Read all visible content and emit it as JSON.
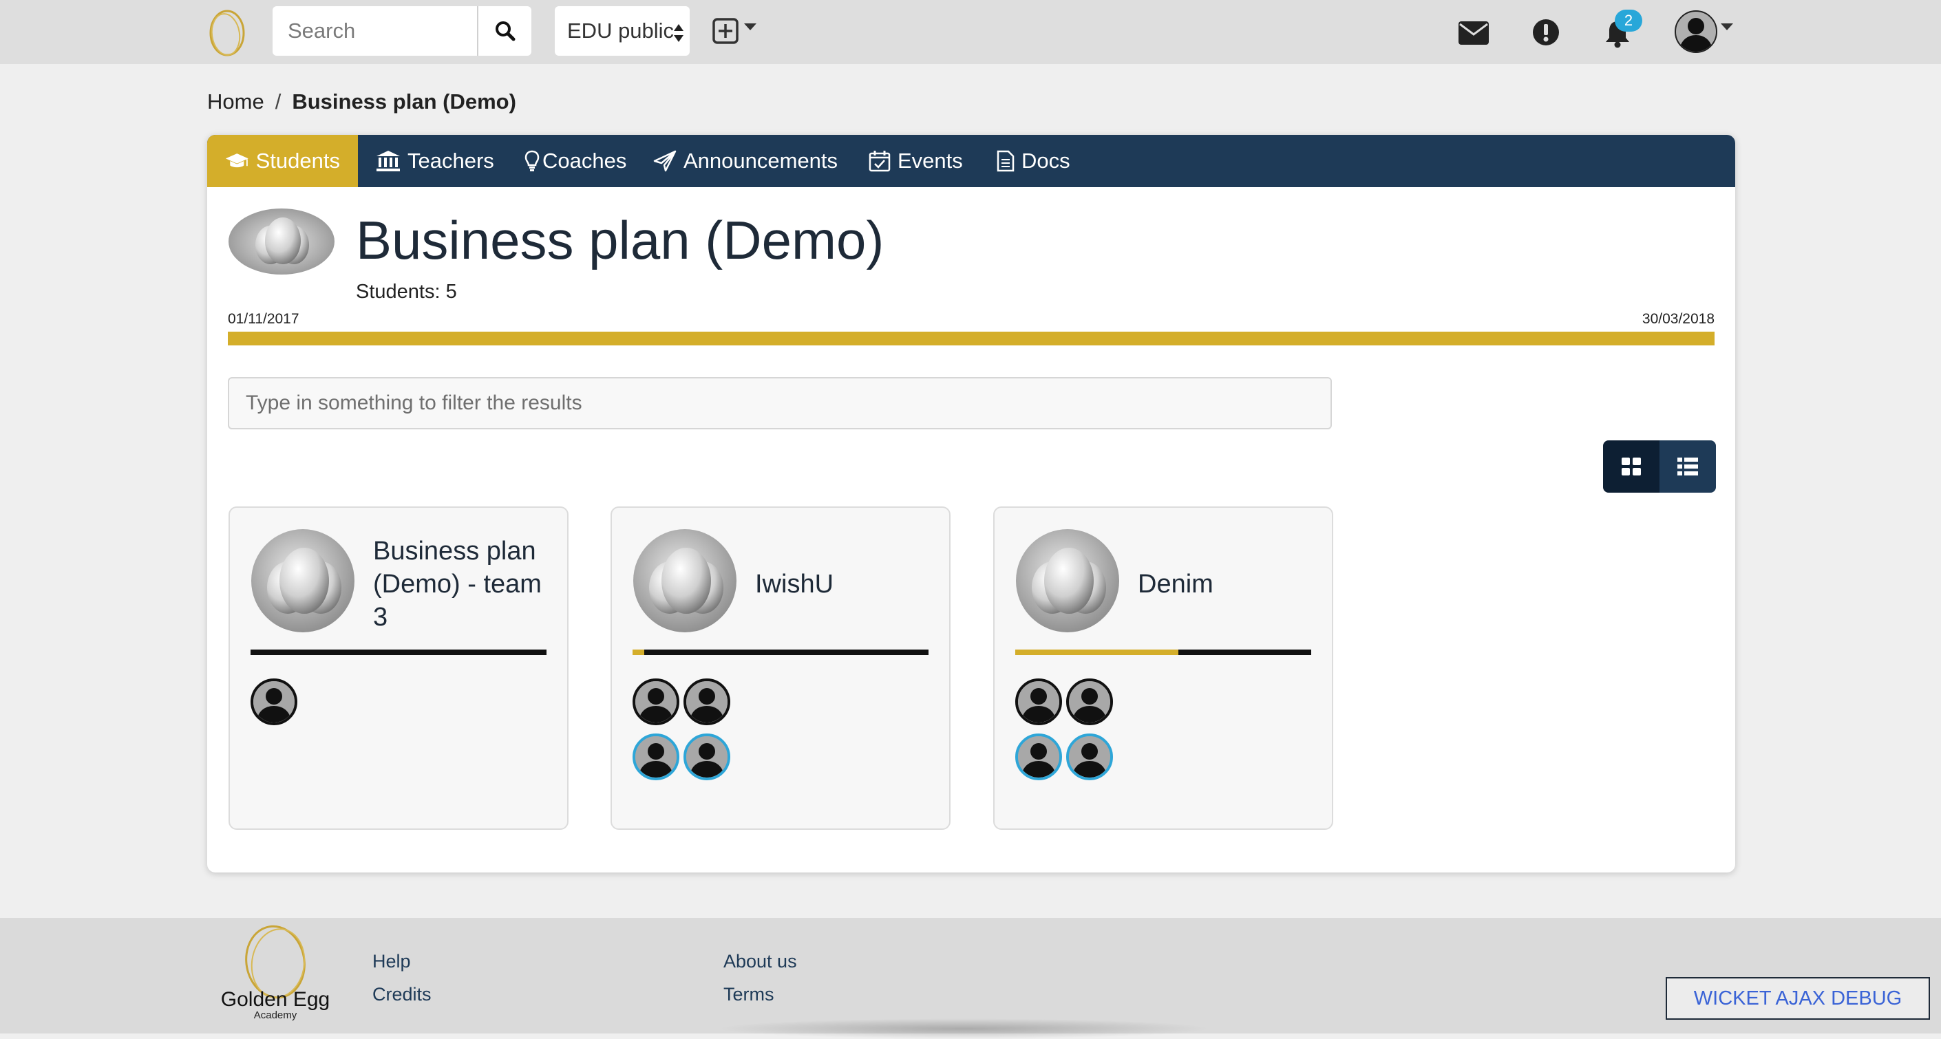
{
  "header": {
    "search_placeholder": "Search",
    "visibility_select": "EDU public",
    "notification_count": "2"
  },
  "breadcrumb": {
    "home": "Home",
    "separator": "/",
    "current": "Business plan (Demo)"
  },
  "tabs": [
    {
      "label": "Students",
      "icon": "graduation-cap-icon",
      "active": true
    },
    {
      "label": "Teachers",
      "icon": "institution-icon",
      "active": false
    },
    {
      "label": "Coaches",
      "icon": "lightbulb-icon",
      "active": false
    },
    {
      "label": "Announcements",
      "icon": "paper-plane-icon",
      "active": false
    },
    {
      "label": "Events",
      "icon": "calendar-check-icon",
      "active": false
    },
    {
      "label": "Docs",
      "icon": "document-icon",
      "active": false
    }
  ],
  "course": {
    "title": "Business plan (Demo)",
    "students_count": "Students: 5",
    "start_date": "01/11/2017",
    "end_date": "30/03/2018",
    "timeline_progress": 1.0
  },
  "filter": {
    "placeholder": "Type in something to filter the results"
  },
  "teams": [
    {
      "name": "Business plan (Demo) - team 3",
      "progress": 0.0,
      "students": 1,
      "coaches": 0
    },
    {
      "name": "IwishU",
      "progress": 0.04,
      "students": 2,
      "coaches": 2
    },
    {
      "name": "Denim",
      "progress": 0.55,
      "students": 2,
      "coaches": 2
    }
  ],
  "footer": {
    "brand": "Golden Egg",
    "brand_sub": "Academy",
    "links_col1": [
      "Help",
      "Credits"
    ],
    "links_col2": [
      "About us",
      "Terms"
    ],
    "debug_button": "WICKET AJAX DEBUG"
  },
  "colors": {
    "navy": "#1e3a57",
    "gold": "#d4ae2a",
    "coach_ring": "#2ea6d8",
    "badge": "#28a7d9"
  }
}
